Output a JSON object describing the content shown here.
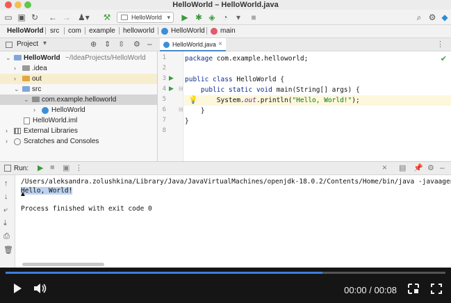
{
  "window": {
    "title": "HelloWorld – HelloWorld.java"
  },
  "toolbar": {
    "run_config": "HelloWorld"
  },
  "breadcrumb": [
    "HelloWorld",
    "src",
    "com",
    "example",
    "helloworld",
    "HelloWorld",
    "main"
  ],
  "project": {
    "header": "Project",
    "tree": [
      {
        "label": "HelloWorld",
        "suffix": "~/IdeaProjects/HelloWorld"
      },
      {
        "label": ".idea"
      },
      {
        "label": "out"
      },
      {
        "label": "src"
      },
      {
        "label": "com.example.helloworld"
      },
      {
        "label": "HelloWorld"
      },
      {
        "label": "HelloWorld.iml"
      },
      {
        "label": "External Libraries"
      },
      {
        "label": "Scratches and Consoles"
      }
    ]
  },
  "editor": {
    "tab": "HelloWorld.java",
    "line_numbers": [
      "1",
      "2",
      "3",
      "4",
      "5",
      "6",
      "7",
      "8"
    ],
    "lines": [
      {
        "kw": "package ",
        "rest": "com.example.helloworld;"
      },
      {
        "kw": "",
        "rest": ""
      },
      {
        "kw": "public class ",
        "rest": "HelloWorld {"
      },
      {
        "kw": "    public static void ",
        "rest": "main(String[] args) {"
      },
      {
        "kw": "        System.",
        "fi": "out",
        "rest": ".println(",
        "str": "\"Hello, World!\"",
        "end": ");"
      },
      {
        "kw": "",
        "rest": "    }"
      },
      {
        "kw": "",
        "rest": "}"
      },
      {
        "kw": "",
        "rest": ""
      }
    ]
  },
  "run": {
    "label": "Run:",
    "console": [
      "/Users/aleksandra.zolushkina/Library/Java/JavaVirtualMachines/openjdk-18.0.2/Contents/Home/bin/java -javaagent:/",
      "Hello, World!",
      "",
      "Process finished with exit code 0"
    ]
  },
  "video": {
    "time": "00:00 / 00:08",
    "progress": 0.72
  },
  "colors": {
    "accent": "#3d7ee0",
    "run_green": "#3c9a3c",
    "folder_blue": "#7ea7d8",
    "folder_orange": "#e3a640"
  }
}
